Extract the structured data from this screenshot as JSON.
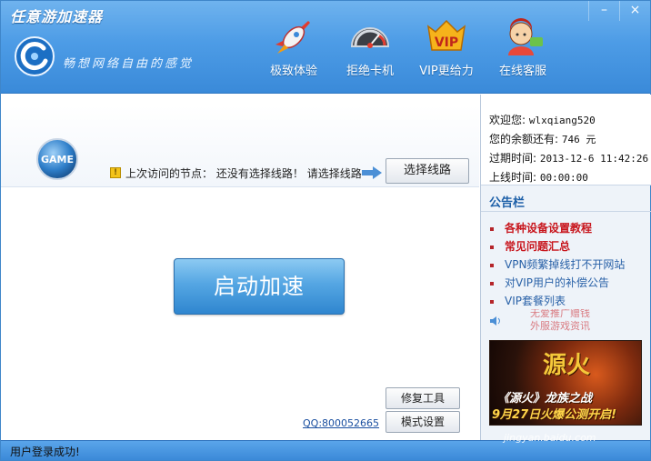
{
  "window": {
    "title": "任意游加速器",
    "slogan": "畅想网络自由的感觉",
    "minimize": "–",
    "close": "×"
  },
  "nav": [
    {
      "label": "极致体验",
      "icon": "rocket-icon"
    },
    {
      "label": "拒绝卡机",
      "icon": "speedometer-icon"
    },
    {
      "label": "VIP更给力",
      "icon": "vip-icon"
    },
    {
      "label": "在线客服",
      "icon": "customer-service-icon"
    }
  ],
  "route": {
    "game_badge": "GAME",
    "last_node_label": "上次访问的节点：",
    "last_node_value": "还没有选择线路！",
    "hint": "请选择线路",
    "select_button": "选择线路"
  },
  "main": {
    "start_button": "启动加速",
    "qq_link": "QQ:800052665",
    "repair_button": "修复工具",
    "mode_button": "模式设置"
  },
  "account": {
    "welcome_label": "欢迎您:",
    "username": "wlxqiang520",
    "balance_label": "您的余额还有:",
    "balance_value": "746 元",
    "expire_label": "过期时间:",
    "expire_value": "2013-12-6 11:42:26",
    "online_label": "上线时间:",
    "online_value": "00:00:00"
  },
  "notice": {
    "title": "公告栏",
    "items": [
      {
        "text": "各种设备设置教程",
        "style": "red"
      },
      {
        "text": "常见问题汇总",
        "style": "red"
      },
      {
        "text": "VPN频繁掉线打不开网站",
        "style": "blue"
      },
      {
        "text": "对VIP用户的补偿公告",
        "style": "blue"
      },
      {
        "text": "VIP套餐列表",
        "style": "blue"
      }
    ],
    "scroll_line1": "无爱推广赠钱",
    "scroll_line2": "外服游戏资讯"
  },
  "banner": {
    "title": "源火",
    "line1": "《源火》龙族之战",
    "line2": "9月27日火爆公测开启!"
  },
  "status": {
    "text": "用户登录成功!"
  },
  "watermark": "jingyan.baidu.com",
  "colors": {
    "header_blue": "#4d9ce6",
    "start_button": "#3f93d9",
    "notice_red": "#c8161d",
    "notice_blue": "#2a62a8"
  }
}
